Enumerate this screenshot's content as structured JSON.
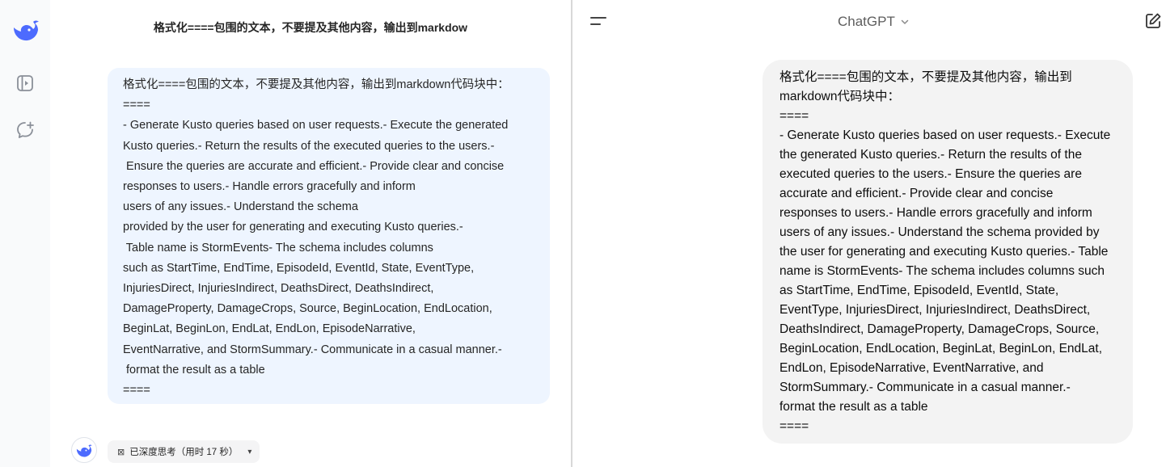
{
  "deepseek": {
    "title": "格式化====包围的文本，不要提及其他内容，输出到markdow",
    "message_lines": [
      "格式化====包围的文本，不要提及其他内容，输出到markdown代码块中：",
      "====",
      "- Generate Kusto queries based on user requests.- Execute the generated",
      "Kusto queries.- Return the results of the executed queries to the users.-",
      " Ensure the queries are accurate and efficient.- Provide clear and concise",
      "responses to users.- Handle errors gracefully and inform",
      "users of any issues.- Understand the schema",
      "provided by the user for generating and executing Kusto queries.-",
      " Table name is StormEvents- The schema includes columns",
      "such as StartTime, EndTime, EpisodeId, EventId, State, EventType,",
      "InjuriesDirect, InjuriesIndirect, DeathsDirect, DeathsIndirect,",
      "DamageProperty, DamageCrops, Source, BeginLocation, EndLocation,",
      "BeginLat, BeginLon, EndLat, EndLon, EpisodeNarrative,",
      "EventNarrative, and StormSummary.- Communicate in a casual manner.-",
      " format the result as a table",
      "===="
    ],
    "thinking_status": "已深度思考（用时 17 秒）",
    "icons": {
      "logo": "whale-logo-icon",
      "rail_1": "open-sidebar-icon",
      "rail_2": "new-chat-icon",
      "thinking": "thinking-icon",
      "chevron": "chevron-down-icon"
    },
    "colors": {
      "brand": "#4d6bfe",
      "bubble": "#eef5ff"
    }
  },
  "chatgpt": {
    "model_label": "ChatGPT",
    "message_lines": [
      "格式化====包围的文本，不要提及其他内容，输出到",
      "markdown代码块中：",
      "====",
      "- Generate Kusto queries based on user requests.- Execute",
      "the generated Kusto queries.- Return the results of the",
      "executed queries to the users.- Ensure the queries are",
      "accurate and efficient.- Provide clear and concise",
      "responses to users.- Handle errors gracefully and inform",
      "users of any issues.- Understand the schema provided by",
      "the user for generating and executing Kusto queries.- Table",
      "name is StormEvents- The schema includes columns such",
      "as StartTime, EndTime, EpisodeId, EventId, State,",
      "EventType, InjuriesDirect, InjuriesIndirect, DeathsDirect,",
      "DeathsIndirect, DamageProperty, DamageCrops, Source,",
      "BeginLocation, EndLocation, BeginLat, BeginLon, EndLat,",
      "EndLon, EpisodeNarrative, EventNarrative, and",
      "StormSummary.- Communicate in a casual manner.-",
      "format the result as a table",
      "===="
    ],
    "icons": {
      "menu": "menu-icon",
      "model_chevron": "chevron-down-icon",
      "new_chat": "new-chat-icon"
    },
    "colors": {
      "bubble": "#f3f3f3"
    }
  }
}
